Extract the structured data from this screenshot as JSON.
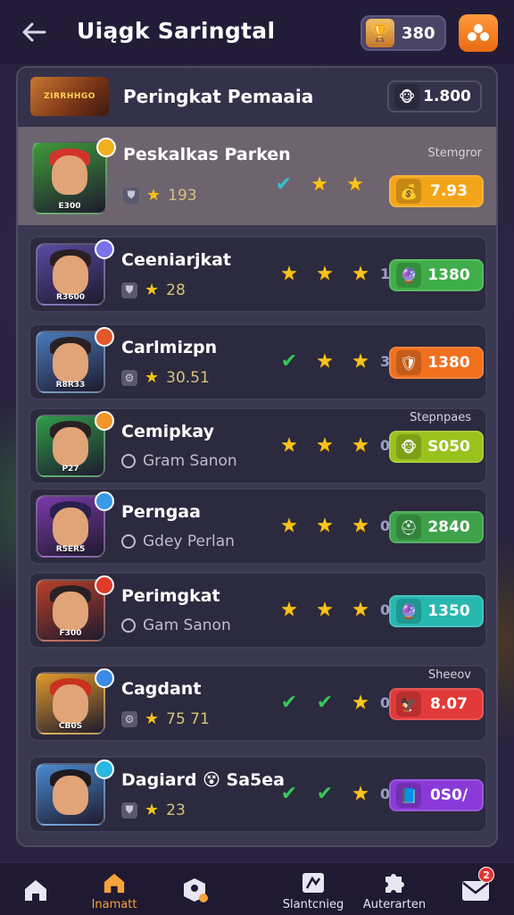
{
  "header": {
    "title": "Uiągk Saringtal",
    "coins": "380",
    "colors": {
      "bar": "#231c38",
      "menu": "#f07a1c"
    }
  },
  "panel": {
    "title": "Peringkat Pemaaia",
    "banner_text": "ZIRRHHGO",
    "score": "1.800",
    "score_color": "#8cc63f"
  },
  "rows": [
    {
      "name": "Peskalkas Parken",
      "sub_icon": "shield",
      "sub_text": "193",
      "sub_type": "stars",
      "marks": [
        "check-teal",
        "star",
        "star"
      ],
      "mark_count": "",
      "caption": "Stemgror",
      "pill_value": "7.93",
      "pill_color": "#f3a51a",
      "pill_icon": "treasure-icon",
      "avatar_label": "E300",
      "avatar_bg": "#3f9a3a",
      "hair_color": "#d2342a",
      "badge_color": "#f2b01e"
    },
    {
      "name": "Ceеniarjkat",
      "sub_icon": "shield",
      "sub_text": "28",
      "sub_type": "stars",
      "marks": [
        "star",
        "star",
        "star"
      ],
      "mark_count": "1",
      "caption": "",
      "pill_value": "1380",
      "pill_color": "#3fae4a",
      "pill_icon": "orb-icon",
      "avatar_label": "R3600",
      "avatar_bg": "#5a4aa0",
      "hair_color": "#2a2024",
      "badge_color": "#7a72e8"
    },
    {
      "name": "Carlmizpn",
      "sub_icon": "gear",
      "sub_text": "30.51",
      "sub_type": "stars",
      "marks": [
        "check",
        "star",
        "star"
      ],
      "mark_count": "3",
      "caption": "",
      "pill_value": "1380",
      "pill_color": "#f0701e",
      "pill_icon": "armor-icon",
      "avatar_label": "R8R33",
      "avatar_bg": "#4a7ab8",
      "hair_color": "#2a2024",
      "badge_color": "#e2582a"
    },
    {
      "name": "Cemipkay",
      "sub_icon": "circle",
      "sub_text": "Gram Sanon",
      "sub_type": "status",
      "marks": [
        "star",
        "star",
        "star"
      ],
      "mark_count": "0",
      "caption": "Stepnpaes",
      "pill_value": "S050",
      "pill_color": "#9ac21c",
      "pill_icon": "monkey-icon",
      "avatar_label": "P27",
      "avatar_bg": "#2f9c48",
      "hair_color": "#2a2024",
      "badge_color": "#f0962a"
    },
    {
      "name": "Perngaa",
      "sub_icon": "circle",
      "sub_text": "Gdey Perlan",
      "sub_type": "status",
      "marks": [
        "star",
        "star",
        "star"
      ],
      "mark_count": "0",
      "caption": "",
      "pill_value": "2840",
      "pill_color": "#3ea24a",
      "pill_icon": "helmet-icon",
      "avatar_label": "R5ER5",
      "avatar_bg": "#7a3aa8",
      "hair_color": "#2a2050",
      "badge_color": "#3a9ae8"
    },
    {
      "name": "Perimgkat",
      "sub_icon": "circle",
      "sub_text": "Gam Sanon",
      "sub_type": "status",
      "marks": [
        "star",
        "star",
        "star"
      ],
      "mark_count": "0",
      "caption": "",
      "pill_value": "1350",
      "pill_color": "#27b8b0",
      "pill_icon": "orb-icon",
      "avatar_label": "F300",
      "avatar_bg": "#b8402a",
      "hair_color": "#2a2024",
      "badge_color": "#e03a2a"
    },
    {
      "name": "Cagdant",
      "sub_icon": "gear",
      "sub_text": "75 71",
      "sub_type": "stars",
      "marks": [
        "check",
        "check",
        "star"
      ],
      "mark_count": "0",
      "caption": "Sheeov",
      "pill_value": "8.07",
      "pill_color": "#e23a3a",
      "pill_icon": "bird-icon",
      "avatar_label": "CB0S",
      "avatar_bg": "#e09a2a",
      "hair_color": "#c8321e",
      "badge_color": "#3a8ae8"
    },
    {
      "name": "Dagiard 😵 Sa5ea",
      "sub_icon": "shield",
      "sub_text": "23",
      "sub_type": "stars",
      "marks": [
        "check",
        "check",
        "star"
      ],
      "mark_count": "0",
      "caption": "",
      "pill_value": "0S0/",
      "pill_color": "#8a3ad8",
      "pill_icon": "book-icon",
      "avatar_label": "",
      "avatar_bg": "#4a8ad0",
      "hair_color": "#1e1a20",
      "badge_color": "#2ab8e0"
    }
  ],
  "nav": {
    "items": [
      {
        "label": "",
        "icon": "home-icon"
      },
      {
        "label": "Inamatt",
        "icon": "house-active-icon"
      },
      {
        "label": "",
        "icon": "profile-settings-icon"
      },
      {
        "label": "Slantcnieg",
        "icon": "chart-icon"
      },
      {
        "label": "Auterarten",
        "icon": "puzzle-icon"
      },
      {
        "label": "",
        "icon": "mail-icon"
      }
    ],
    "mail_badge": "2"
  }
}
